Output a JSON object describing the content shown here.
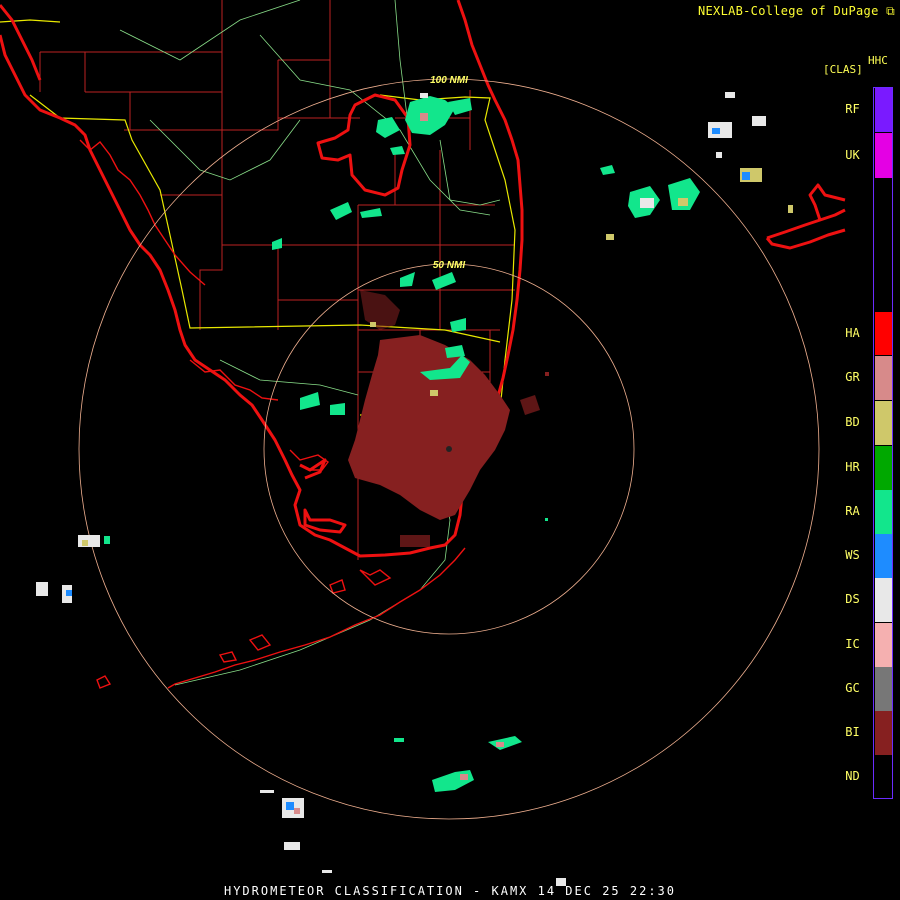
{
  "header": {
    "credit": "NEXLAB-College of DuPage"
  },
  "product": {
    "code": "HHC",
    "name": "[CLAS]"
  },
  "footer": {
    "title": "HYDROMETEOR CLASSIFICATION - KAMX 14 DEC 25 22:30"
  },
  "range_rings": {
    "outer_label": "100 NMI",
    "inner_label": "50 NMI"
  },
  "legend": [
    {
      "code": "RF",
      "color": "#7a1aff"
    },
    {
      "code": "UK",
      "color": "#e400e4"
    },
    {
      "code": "HA",
      "color": "#ff0000"
    },
    {
      "code": "GR",
      "color": "#d78a8a"
    },
    {
      "code": "BD",
      "color": "#cfc86a"
    },
    {
      "code": "HR",
      "color": "#00a800"
    },
    {
      "code": "RA",
      "color": "#12e68c"
    },
    {
      "code": "WS",
      "color": "#1e8cff"
    },
    {
      "code": "DS",
      "color": "#e8e8e8"
    },
    {
      "code": "IC",
      "color": "#f5b0b0"
    },
    {
      "code": "GC",
      "color": "#777777"
    },
    {
      "code": "BI",
      "color": "#862020"
    },
    {
      "code": "ND",
      "color": "#000000"
    }
  ],
  "colors": {
    "coast": "#ee1111",
    "county": "#bb2222",
    "highway": "#e8e800",
    "road": "#88dd88",
    "ring": "#f0b090"
  },
  "icons": {
    "credit_icon": "external-link-icon"
  }
}
